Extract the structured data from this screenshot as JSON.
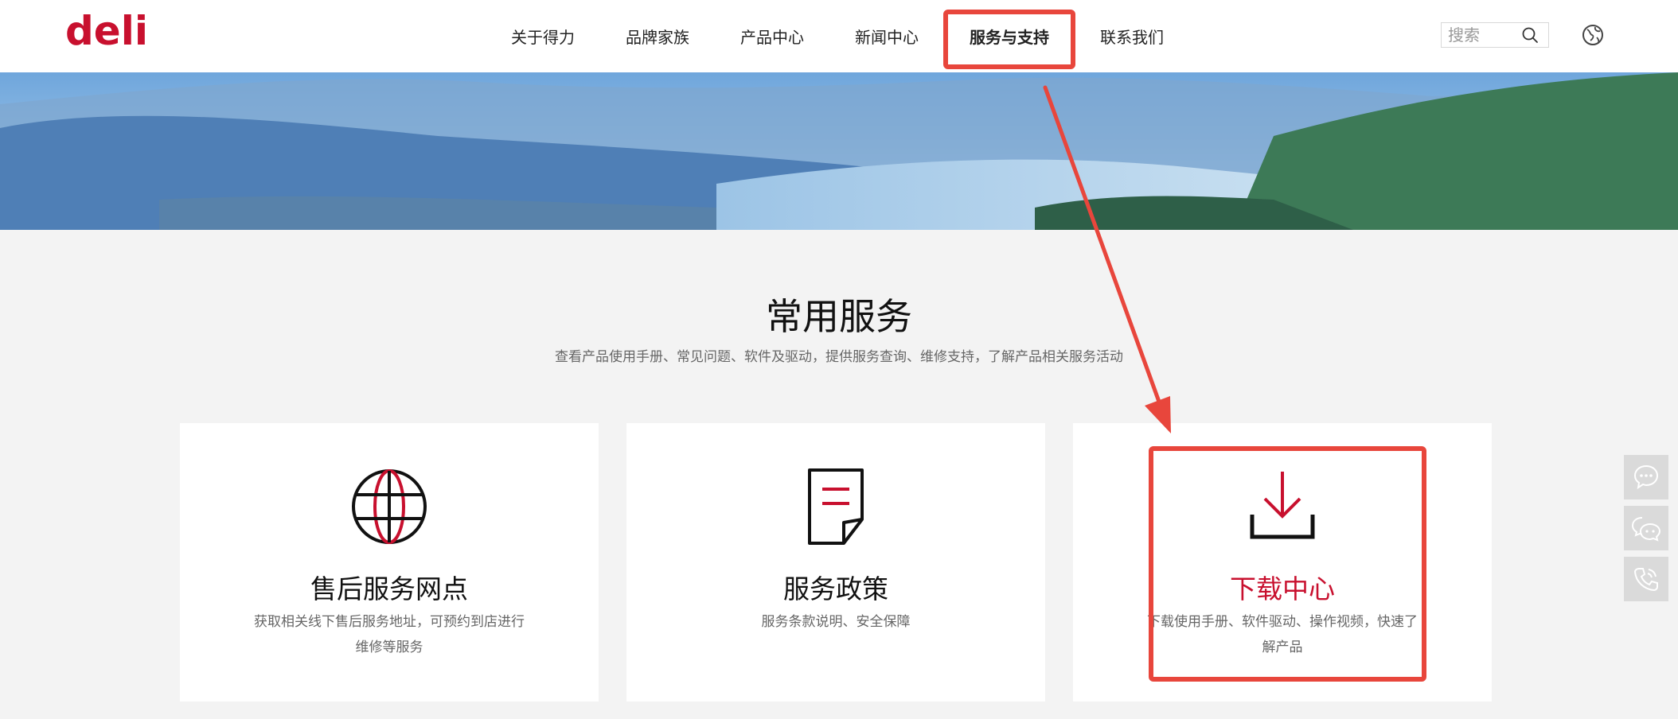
{
  "header": {
    "logo_text": "deli",
    "nav": [
      {
        "label": "关于得力",
        "active": false
      },
      {
        "label": "品牌家族",
        "active": false
      },
      {
        "label": "产品中心",
        "active": false
      },
      {
        "label": "新闻中心",
        "active": false
      },
      {
        "label": "服务与支持",
        "active": true
      },
      {
        "label": "联系我们",
        "active": false
      }
    ],
    "search": {
      "placeholder": "搜索",
      "value": ""
    },
    "icons": {
      "search": "search-icon",
      "language": "globe-icon"
    }
  },
  "section": {
    "title": "常用服务",
    "description": "查看产品使用手册、常见问题、软件及驱动，提供服务查询、维修支持，了解产品相关服务活动"
  },
  "cards": [
    {
      "title": "售后服务网点",
      "description": "获取相关线下售后服务地址，可预约到店进行维修等服务",
      "icon": "globe-icon"
    },
    {
      "title": "服务政策",
      "description": "服务条款说明、安全保障",
      "icon": "document-icon"
    },
    {
      "title": "下载中心",
      "description": "下载使用手册、软件驱动、操作视频，快速了解产品",
      "icon": "download-icon"
    }
  ],
  "float_bar": [
    "chat-bubble-icon",
    "wechat-icon",
    "phone-icon"
  ],
  "colors": {
    "brand": "#c8102e",
    "annotation": "#e8463c",
    "background": "#f3f3f3"
  }
}
